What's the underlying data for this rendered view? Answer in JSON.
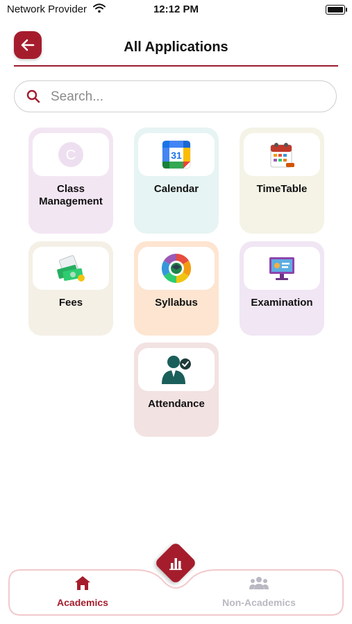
{
  "status_bar": {
    "carrier": "Network Provider",
    "time": "12:12 PM",
    "wifi_icon": "wifi-icon",
    "battery_icon": "battery-icon"
  },
  "header": {
    "title": "All Applications",
    "back_icon": "arrow-left-icon"
  },
  "search": {
    "placeholder": "Search...",
    "icon": "search-icon"
  },
  "apps": [
    {
      "label": "Class Management",
      "icon": "class-management-icon",
      "letter": "C",
      "bg": "#f3e6f3"
    },
    {
      "label": "Calendar",
      "icon": "google-calendar-icon",
      "day": "31",
      "bg": "#e6f4f3"
    },
    {
      "label": "TimeTable",
      "icon": "timetable-icon",
      "bg": "#f4f3e6"
    },
    {
      "label": "Fees",
      "icon": "fees-money-icon",
      "bg": "#f4f0e6"
    },
    {
      "label": "Syllabus",
      "icon": "syllabus-icon",
      "bg": "#fde5d1"
    },
    {
      "label": "Examination",
      "icon": "examination-monitor-icon",
      "bg": "#f0e6f4"
    },
    {
      "label": "Attendance",
      "icon": "attendance-person-icon",
      "bg": "#f3e2e2"
    }
  ],
  "bottom_nav": {
    "fab_icon": "chart-icon",
    "items": [
      {
        "label": "Academics",
        "icon": "home-icon",
        "active": true
      },
      {
        "label": "Non-Academics",
        "icon": "group-icon",
        "active": false
      }
    ]
  },
  "colors": {
    "brand": "#a51d2d",
    "nav_active": "#a51d2d",
    "nav_inactive": "#b9b9c3"
  }
}
